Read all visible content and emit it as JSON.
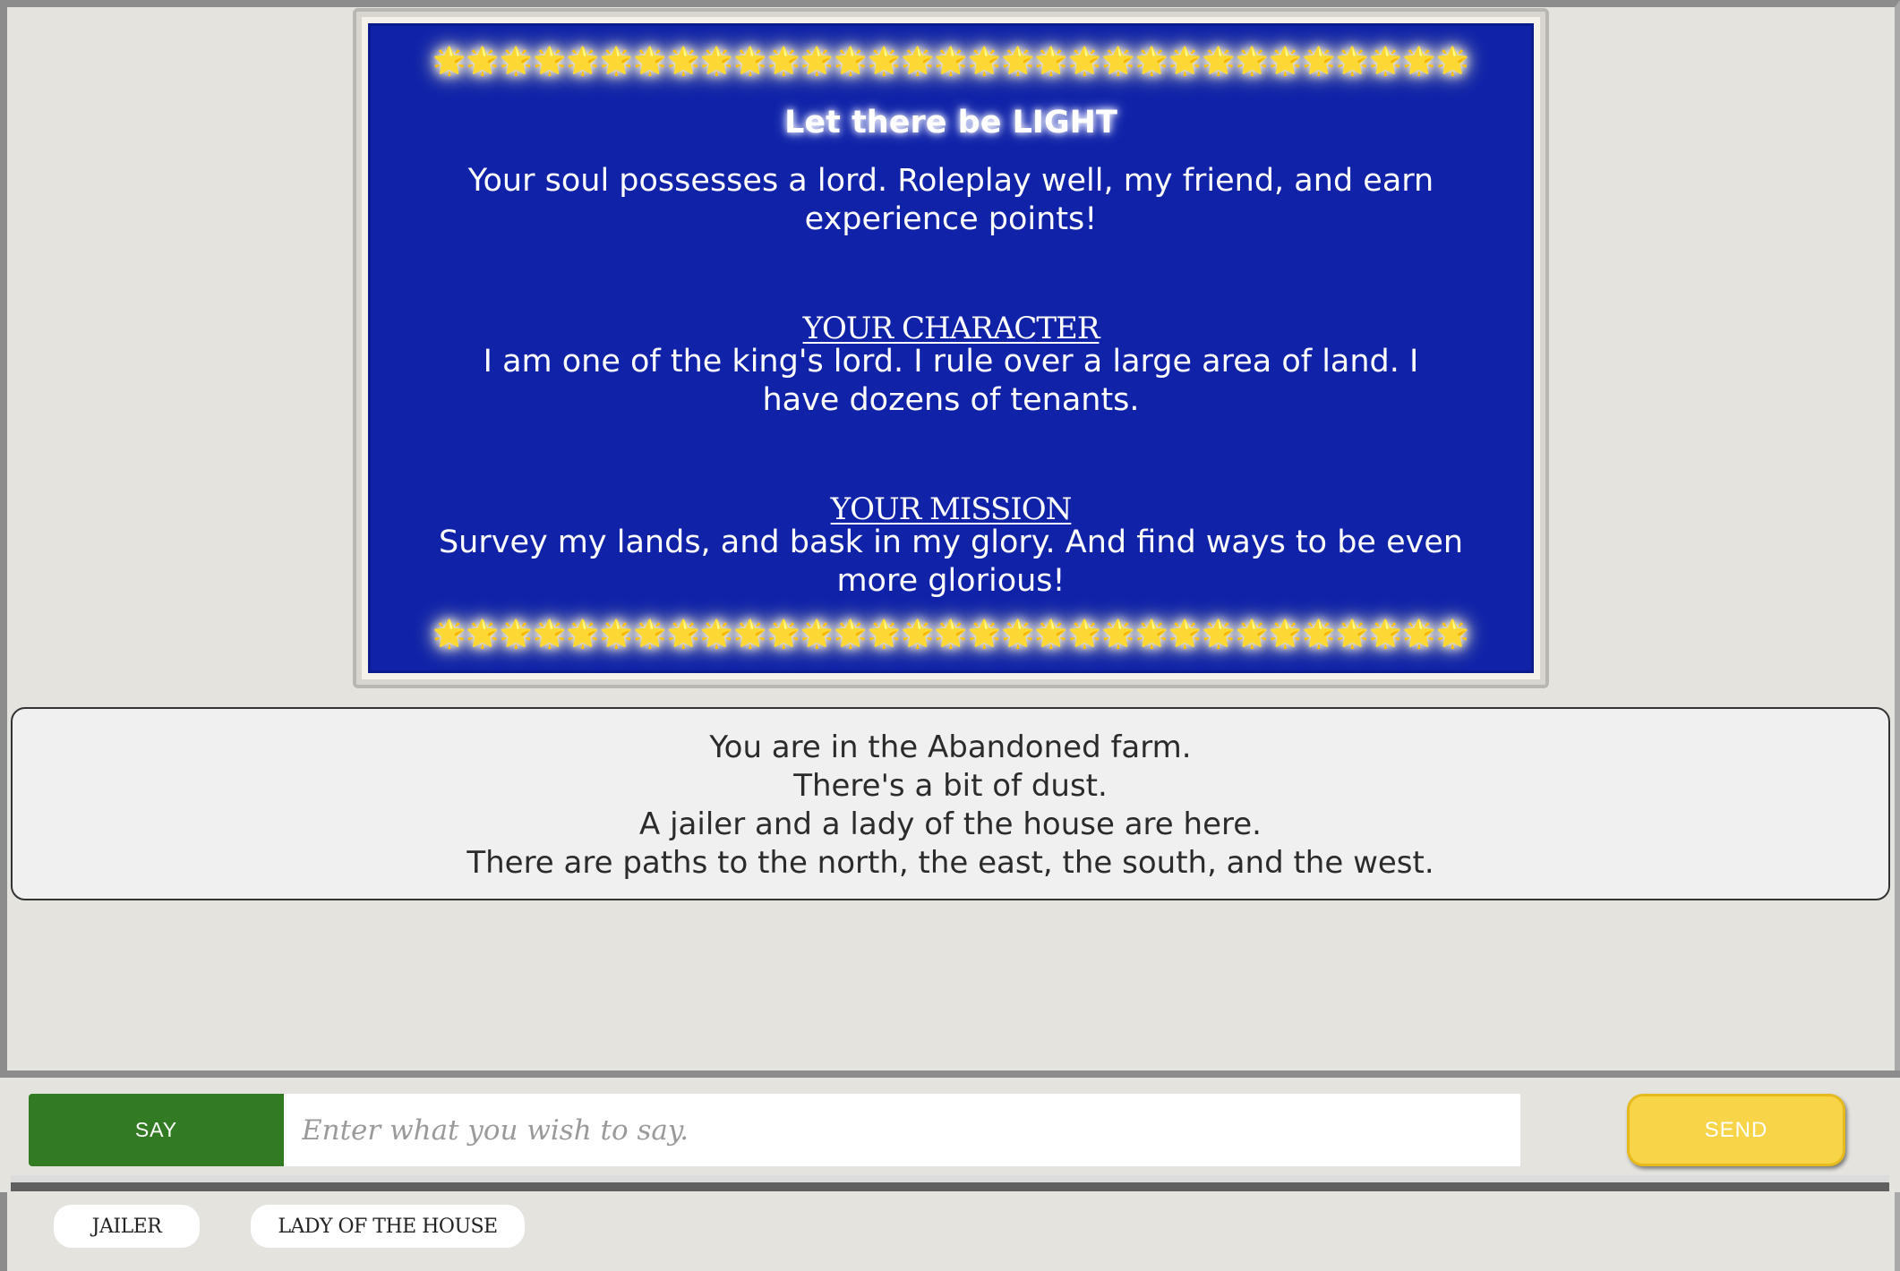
{
  "banner": {
    "stars": "🌟🌟🌟🌟🌟🌟🌟🌟🌟🌟🌟🌟🌟🌟🌟🌟🌟🌟🌟🌟🌟🌟🌟🌟🌟🌟🌟🌟🌟🌟🌟",
    "title": "Let there be LIGHT",
    "intro": "Your soul possesses a lord. Roleplay well, my friend, and earn experience points!",
    "character_heading": "YOUR CHARACTER",
    "character_text": "I am one of the king's lord.  I rule over a large area of land.  I have dozens of tenants.",
    "mission_heading": "YOUR MISSION",
    "mission_text": "Survey my lands, and bask in my glory. And find ways to be even more glorious!"
  },
  "location": {
    "lines": [
      "You are in the Abandoned farm.",
      "There's a bit of dust.",
      "A jailer and a lady of the house are here.",
      "There are paths to the north, the east, the south, and the west."
    ]
  },
  "input": {
    "mode_label": "SAY",
    "placeholder": "Enter what you wish to say.",
    "value": "",
    "send_label": "SEND"
  },
  "npcs": [
    {
      "label": "JAILER"
    },
    {
      "label": "LADY OF THE HOUSE"
    }
  ],
  "colors": {
    "banner_bg": "#1023a8",
    "say_bg": "#327b23",
    "send_bg": "#f8d548",
    "page_bg": "#e4e3de"
  }
}
